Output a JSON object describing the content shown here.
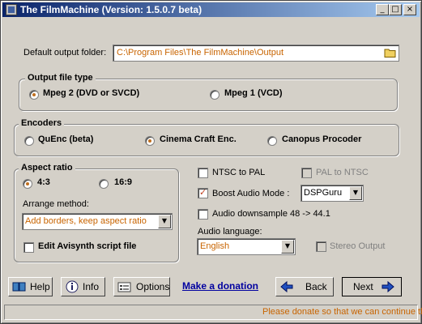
{
  "window": {
    "title": "The FilmMachine  (Version: 1.5.0.7 beta)",
    "minimize": "_",
    "maximize": "□",
    "close": "×"
  },
  "output_folder": {
    "label": "Default output folder:",
    "value": "C:\\Program Files\\The FilmMachine\\Output"
  },
  "output_type": {
    "title": "Output file type",
    "options": [
      "Mpeg 2 (DVD or SVCD)",
      "Mpeg 1 (VCD)"
    ],
    "selected": 0
  },
  "encoders": {
    "title": "Encoders",
    "options": [
      "QuEnc (beta)",
      "Cinema Craft Enc.",
      "Canopus Procoder"
    ],
    "selected": 1
  },
  "aspect": {
    "title": "Aspect ratio",
    "options": [
      "4:3",
      "16:9"
    ],
    "selected": 0,
    "arrange_label": "Arrange method:",
    "arrange_value": "Add borders, keep aspect ratio",
    "avisynth_label": "Edit Avisynth script file",
    "avisynth_checked": false
  },
  "options": {
    "ntsc_to_pal": "NTSC to PAL",
    "ntsc_to_pal_checked": false,
    "pal_to_ntsc": "PAL to NTSC",
    "pal_to_ntsc_checked": false,
    "boost_audio": "Boost Audio Mode :",
    "boost_audio_checked": true,
    "boost_audio_value": "DSPGuru",
    "audio_downsample": "Audio downsample 48 -> 44.1",
    "audio_downsample_checked": false,
    "audio_language_label": "Audio language:",
    "audio_language_value": "English",
    "stereo_output": "Stereo Output",
    "stereo_output_checked": false
  },
  "buttons": {
    "help": "Help",
    "info": "Info",
    "options": "Options",
    "donation": "Make a donation",
    "back": "Back",
    "next": "Next"
  },
  "status": {
    "text": "Please donate so that we can continue the"
  },
  "colors": {
    "title_start": "#0a246a",
    "title_end": "#a6caf0",
    "accent_orange": "#c86400",
    "link_blue": "#0000a0",
    "face": "#d4d0c8"
  },
  "icons": {
    "folder": "folder-icon",
    "help": "help-icon",
    "info": "info-icon",
    "options": "options-icon",
    "back": "back-arrow-icon",
    "next": "next-arrow-icon"
  }
}
